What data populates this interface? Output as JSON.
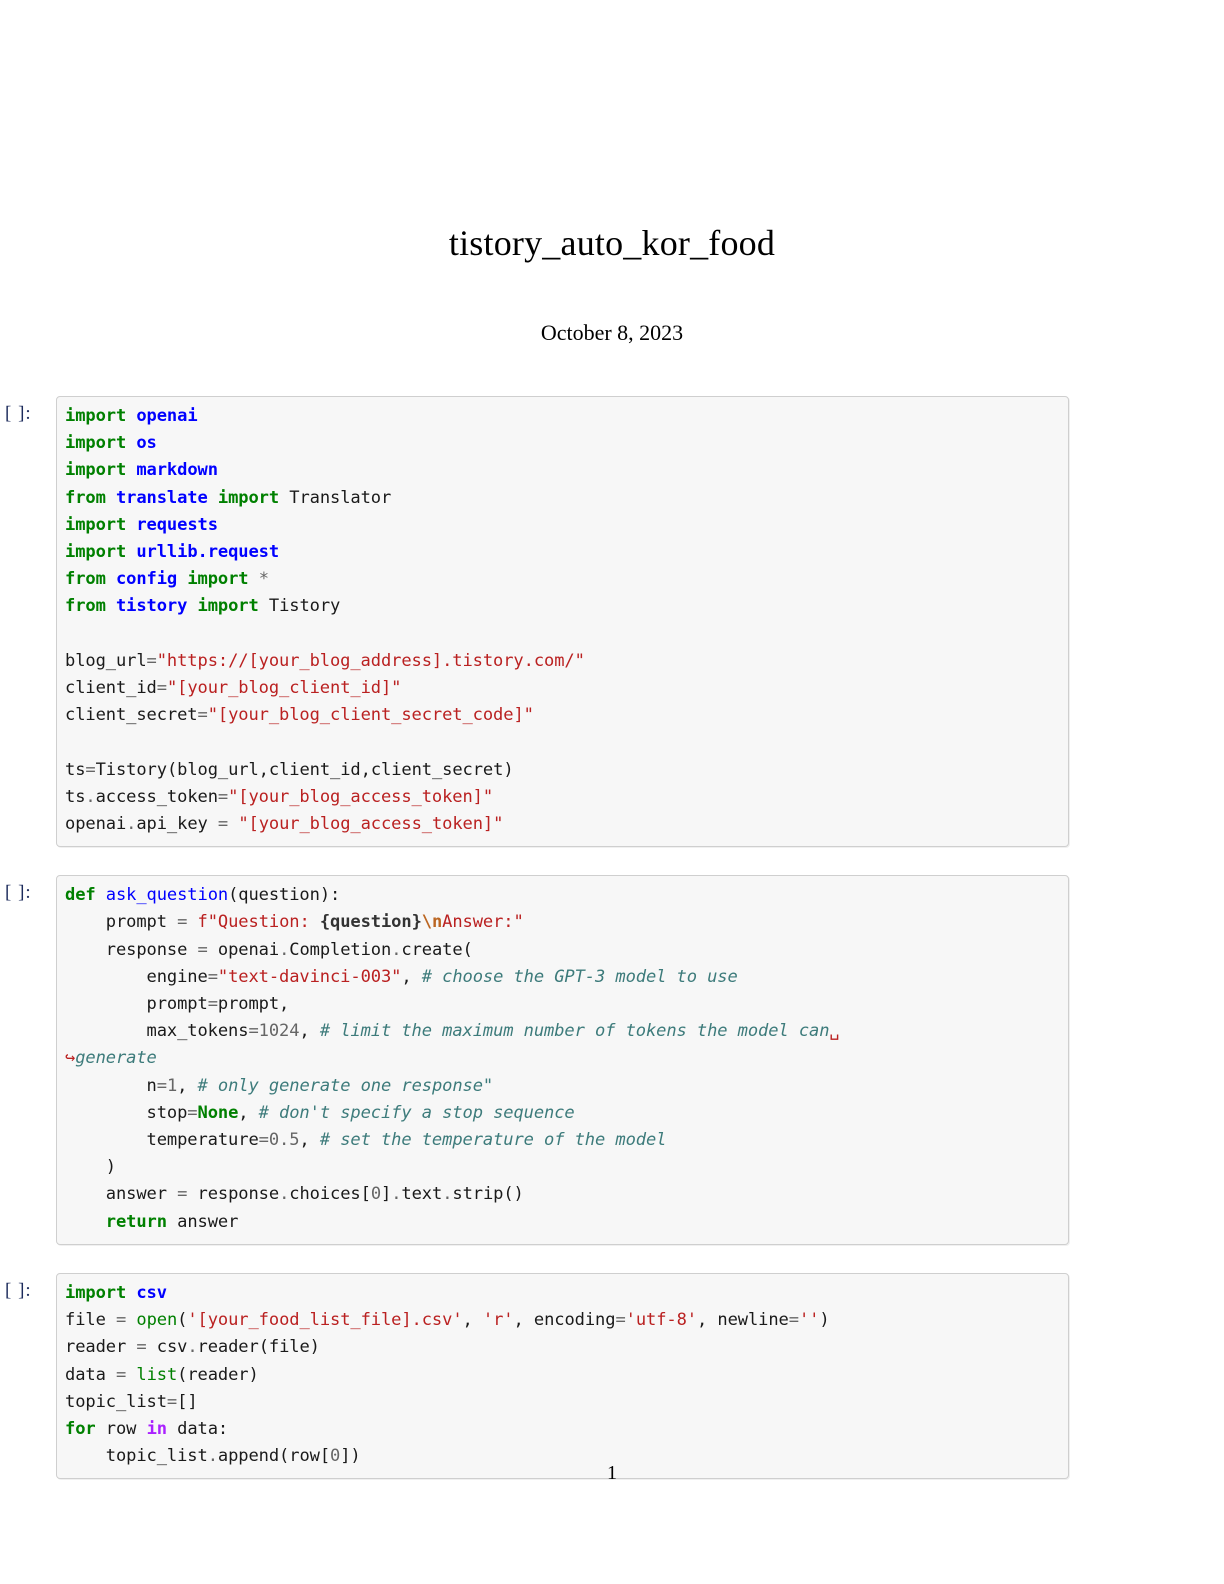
{
  "document": {
    "title": "tistory__auto__kor__food",
    "title_display": "tistory_auto_kor_food",
    "date": "October 8, 2023",
    "page_number": "1"
  },
  "colors": {
    "keyword": "#008000",
    "module": "#0000ff",
    "string": "#ba2121",
    "comment": "#3d7b7b",
    "number": "#666666",
    "escape": "#bb6622",
    "operator_word": "#aa22ff",
    "prompt": "#1b2a5b",
    "cell_background": "#f7f7f7",
    "cell_border": "#cfcfcf"
  },
  "cells": [
    {
      "prompt": "[ ]:",
      "lines": [
        "import openai",
        "import os",
        "import markdown",
        "from translate import Translator",
        "import requests",
        "import urllib.request",
        "from config import *",
        "from tistory import Tistory",
        "",
        "blog_url=\"https://[your_blog_address].tistory.com/\"",
        "client_id=\"[your_blog_client_id]\"",
        "client_secret=\"[your_blog_client_secret_code]\"",
        "",
        "ts=Tistory(blog_url,client_id,client_secret)",
        "ts.access_token=\"[your_blog_access_token]\"",
        "openai.api_key = \"[your_blog_access_token]\""
      ]
    },
    {
      "prompt": "[ ]:",
      "lines": [
        "def ask_question(question):",
        "    prompt = f\"Question: {question}\\nAnswer:\"",
        "    response = openai.Completion.create(",
        "        engine=\"text-davinci-003\", # choose the GPT-3 model to use",
        "        prompt=prompt,",
        "        max_tokens=1024, # limit the maximum number of tokens the model can generate",
        "        n=1, # only generate one response\"",
        "        stop=None, # don't specify a stop sequence",
        "        temperature=0.5, # set the temperature of the model",
        "    )",
        "    answer = response.choices[0].text.strip()",
        "    return answer"
      ]
    },
    {
      "prompt": "[ ]:",
      "lines": [
        "import csv",
        "file = open('[your_food_list_file].csv', 'r', encoding='utf-8', newline='')",
        "reader = csv.reader(file)",
        "data = list(reader)",
        "topic_list=[]",
        "for row in data:",
        "    topic_list.append(row[0])"
      ]
    }
  ],
  "wrap_markers": {
    "line_end": "␣",
    "continuation": "↪"
  }
}
